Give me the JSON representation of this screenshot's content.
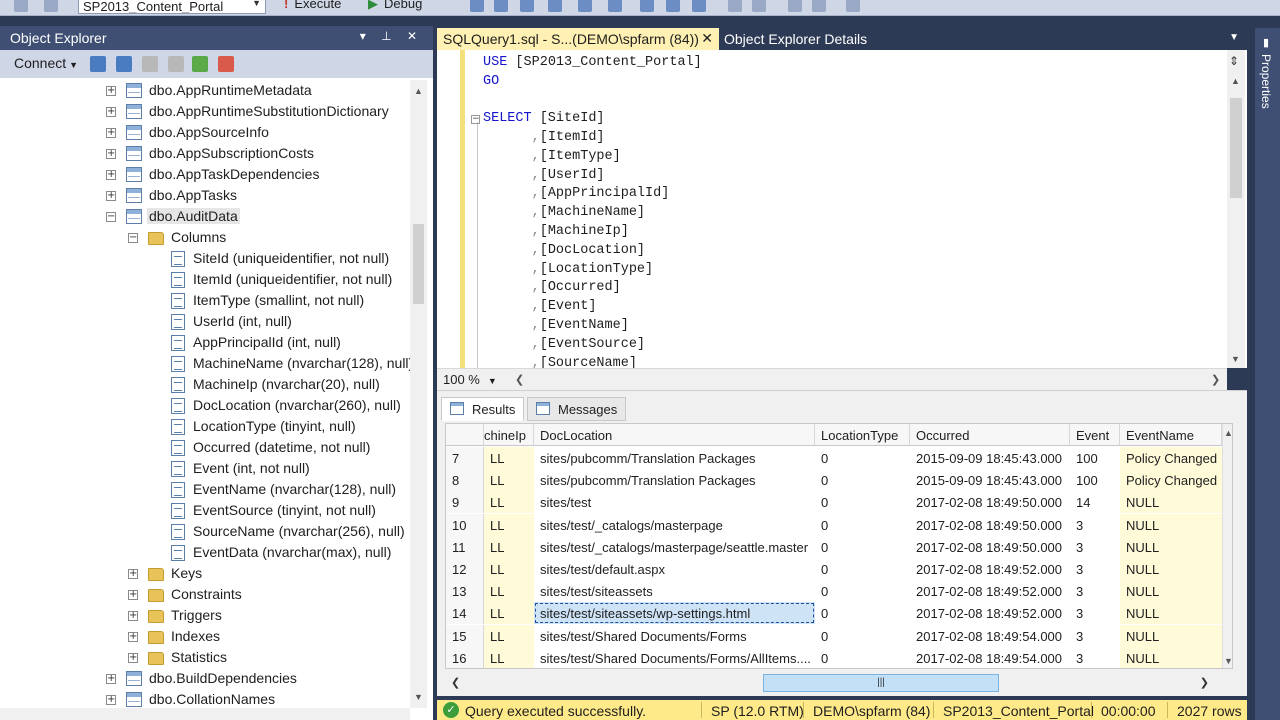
{
  "toolbar": {
    "database": "SP2013_Content_Portal",
    "execute_label": "Execute",
    "debug_label": "Debug"
  },
  "object_explorer": {
    "title": "Object Explorer",
    "connect_label": "Connect",
    "tree": [
      {
        "label": "dbo.AppRuntimeMetadata",
        "type": "table",
        "expander": "+"
      },
      {
        "label": "dbo.AppRuntimeSubstitutionDictionary",
        "type": "table",
        "expander": "+"
      },
      {
        "label": "dbo.AppSourceInfo",
        "type": "table",
        "expander": "+"
      },
      {
        "label": "dbo.AppSubscriptionCosts",
        "type": "table",
        "expander": "+"
      },
      {
        "label": "dbo.AppTaskDependencies",
        "type": "table",
        "expander": "+"
      },
      {
        "label": "dbo.AppTasks",
        "type": "table",
        "expander": "+"
      },
      {
        "label": "dbo.AuditData",
        "type": "table",
        "expander": "−"
      },
      {
        "label": "Columns",
        "type": "folder",
        "expander": "−"
      },
      {
        "label": "SiteId (uniqueidentifier, not null)",
        "type": "column",
        "expander": ""
      },
      {
        "label": "ItemId (uniqueidentifier, not null)",
        "type": "column",
        "expander": ""
      },
      {
        "label": "ItemType (smallint, not null)",
        "type": "column",
        "expander": ""
      },
      {
        "label": "UserId (int, null)",
        "type": "column",
        "expander": ""
      },
      {
        "label": "AppPrincipalId (int, null)",
        "type": "column",
        "expander": ""
      },
      {
        "label": "MachineName (nvarchar(128), null)",
        "type": "column",
        "expander": ""
      },
      {
        "label": "MachineIp (nvarchar(20), null)",
        "type": "column",
        "expander": ""
      },
      {
        "label": "DocLocation (nvarchar(260), null)",
        "type": "column",
        "expander": ""
      },
      {
        "label": "LocationType (tinyint, null)",
        "type": "column",
        "expander": ""
      },
      {
        "label": "Occurred (datetime, not null)",
        "type": "column",
        "expander": ""
      },
      {
        "label": "Event (int, not null)",
        "type": "column",
        "expander": ""
      },
      {
        "label": "EventName (nvarchar(128), null)",
        "type": "column",
        "expander": ""
      },
      {
        "label": "EventSource (tinyint, not null)",
        "type": "column",
        "expander": ""
      },
      {
        "label": "SourceName (nvarchar(256), null)",
        "type": "column",
        "expander": ""
      },
      {
        "label": "EventData (nvarchar(max), null)",
        "type": "column",
        "expander": ""
      },
      {
        "label": "Keys",
        "type": "folder",
        "expander": "+"
      },
      {
        "label": "Constraints",
        "type": "folder",
        "expander": "+"
      },
      {
        "label": "Triggers",
        "type": "folder",
        "expander": "+"
      },
      {
        "label": "Indexes",
        "type": "folder",
        "expander": "+"
      },
      {
        "label": "Statistics",
        "type": "folder",
        "expander": "+"
      },
      {
        "label": "dbo.BuildDependencies",
        "type": "table",
        "expander": "+"
      },
      {
        "label": "dbo.CollationNames",
        "type": "table",
        "expander": "+"
      }
    ]
  },
  "tabs": {
    "query": "SQLQuery1.sql - S...(DEMO\\spfarm (84))",
    "query_close": "✕",
    "details": "Object Explorer Details"
  },
  "editor": {
    "use_kw": "USE",
    "use_db": " [SP2013_Content_Portal]",
    "go": "GO",
    "select_kw": "SELECT",
    "first_col": " [SiteId]",
    "columns": [
      "[ItemId]",
      "[ItemType]",
      "[UserId]",
      "[AppPrincipalId]",
      "[MachineName]",
      "[MachineIp]",
      "[DocLocation]",
      "[LocationType]",
      "[Occurred]",
      "[Event]",
      "[EventName]",
      "[EventSource]",
      "[SourceName]"
    ],
    "zoom": "100 %"
  },
  "results": {
    "results_tab": "Results",
    "messages_tab": "Messages",
    "headers": [
      "chineIp",
      "DocLocation",
      "LocationType",
      "Occurred",
      "Event",
      "EventName"
    ],
    "rows": [
      {
        "n": "7",
        "ip": "LL",
        "doc": "sites/pubcomm/Translation Packages",
        "lt": "0",
        "occ": "2015-09-09 18:45:43.000",
        "ev": "100",
        "name": "Policy Changed"
      },
      {
        "n": "8",
        "ip": "LL",
        "doc": "sites/pubcomm/Translation Packages",
        "lt": "0",
        "occ": "2015-09-09 18:45:43.000",
        "ev": "100",
        "name": "Policy Changed"
      },
      {
        "n": "9",
        "ip": "LL",
        "doc": "sites/test",
        "lt": "0",
        "occ": "2017-02-08 18:49:50.000",
        "ev": "14",
        "name": "NULL"
      },
      {
        "n": "10",
        "ip": "LL",
        "doc": "sites/test/_catalogs/masterpage",
        "lt": "0",
        "occ": "2017-02-08 18:49:50.000",
        "ev": "3",
        "name": "NULL"
      },
      {
        "n": "11",
        "ip": "LL",
        "doc": "sites/test/_catalogs/masterpage/seattle.master",
        "lt": "0",
        "occ": "2017-02-08 18:49:50.000",
        "ev": "3",
        "name": "NULL"
      },
      {
        "n": "12",
        "ip": "LL",
        "doc": "sites/test/default.aspx",
        "lt": "0",
        "occ": "2017-02-08 18:49:52.000",
        "ev": "3",
        "name": "NULL"
      },
      {
        "n": "13",
        "ip": "LL",
        "doc": "sites/test/siteassets",
        "lt": "0",
        "occ": "2017-02-08 18:49:52.000",
        "ev": "3",
        "name": "NULL"
      },
      {
        "n": "14",
        "ip": "LL",
        "doc": "sites/test/siteassets/wp-settings.html",
        "lt": "0",
        "occ": "2017-02-08 18:49:52.000",
        "ev": "3",
        "name": "NULL"
      },
      {
        "n": "15",
        "ip": "LL",
        "doc": "sites/test/Shared Documents/Forms",
        "lt": "0",
        "occ": "2017-02-08 18:49:54.000",
        "ev": "3",
        "name": "NULL"
      },
      {
        "n": "16",
        "ip": "LL",
        "doc": "sites/test/Shared Documents/Forms/AllItems....",
        "lt": "0",
        "occ": "2017-02-08 18:49:54.000",
        "ev": "3",
        "name": "NULL"
      }
    ]
  },
  "status": {
    "message": "Query executed successfully.",
    "server": "SP (12.0 RTM)",
    "user": "DEMO\\spfarm (84)",
    "database": "SP2013_Content_Portal",
    "time": "00:00:00",
    "rows": "2027 rows"
  },
  "properties": {
    "label": "Properties"
  },
  "colors": {
    "accent_tab": "#fff1b3",
    "panel_title": "#3f4f73",
    "statusbar": "#ffea8a",
    "keyword": "#1515cc"
  }
}
